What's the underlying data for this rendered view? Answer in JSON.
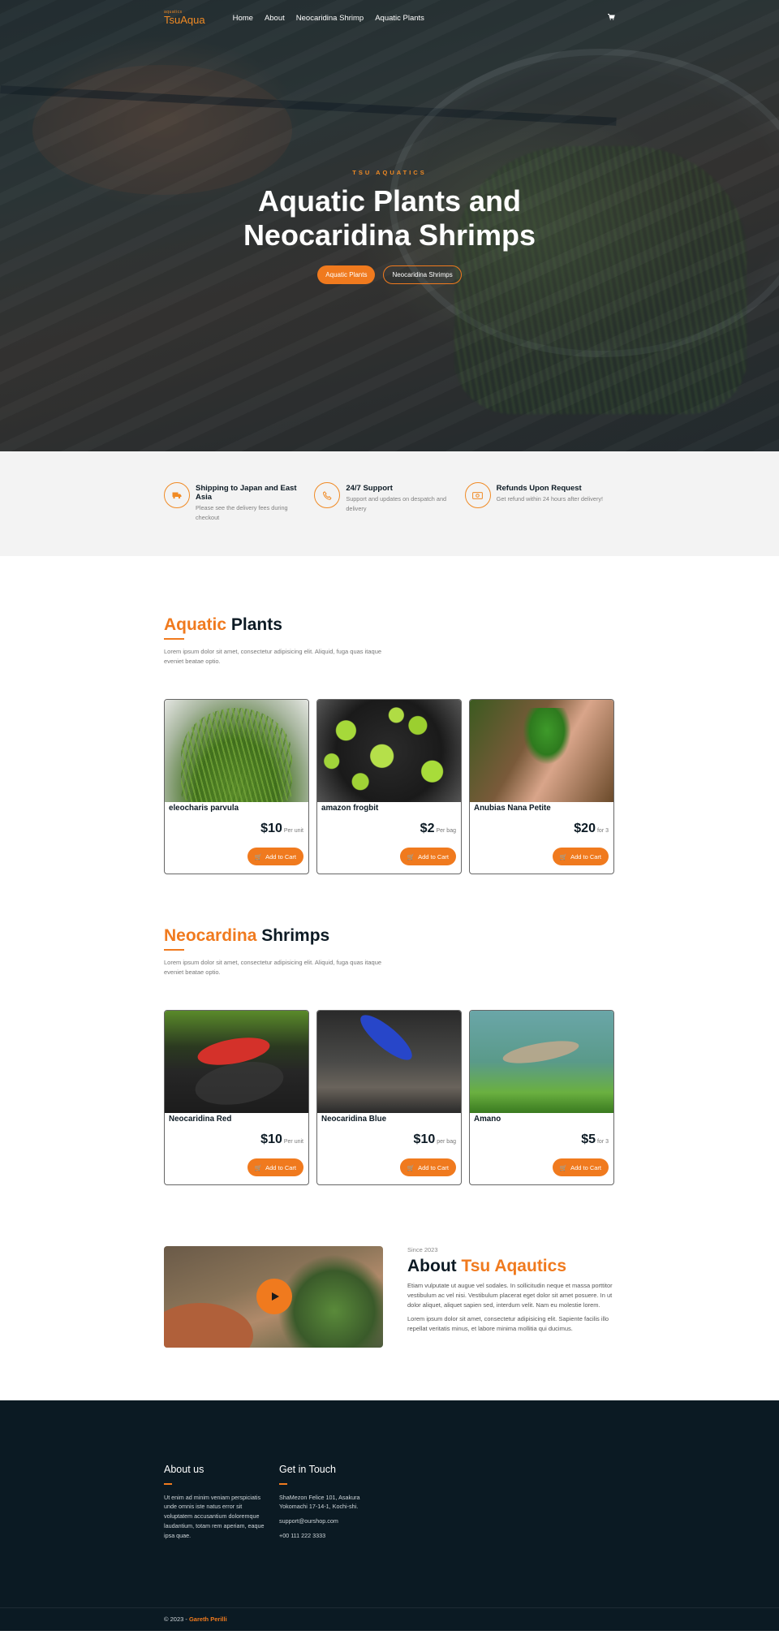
{
  "nav": {
    "logo_small": "aquatics",
    "logo": "TsuAqua",
    "links": [
      "Home",
      "About",
      "Neocaridina Shrimp",
      "Aquatic Plants"
    ],
    "cart_icon": "cart-icon"
  },
  "hero": {
    "eyebrow": "TSU AQUATICS",
    "title_line1": "Aquatic Plants and",
    "title_line2": "Neocaridina Shrimps",
    "btn_primary": "Aquatic Plants",
    "btn_secondary": "Neocaridina Shrimps"
  },
  "features": [
    {
      "icon": "truck-icon",
      "title": "Shipping to Japan and East Asia",
      "desc": "Please see the delivery fees during checkout"
    },
    {
      "icon": "phone-icon",
      "title": "24/7 Support",
      "desc": "Support and updates on despatch and delivery"
    },
    {
      "icon": "money-icon",
      "title": "Refunds Upon Request",
      "desc": "Get refund within 24 hours after delivery!"
    }
  ],
  "plants": {
    "title_accent": "Aquatic",
    "title_rest": " Plants",
    "desc": "Lorem ipsum dolor sit amet, consectetur adipisicing elit. Aliquid, fuga quas itaque eveniet beatae optio.",
    "items": [
      {
        "name": "eleocharis parvula",
        "price": "$10",
        "unit": "Per unit",
        "button": "Add to Cart"
      },
      {
        "name": "amazon frogbit",
        "price": "$2",
        "unit": "Per bag",
        "button": "Add to Cart"
      },
      {
        "name": "Anubias Nana Petite",
        "price": "$20",
        "unit": "for 3",
        "button": "Add to Cart"
      }
    ]
  },
  "shrimps": {
    "title_accent": "Neocardina",
    "title_rest": " Shrimps",
    "desc": "Lorem ipsum dolor sit amet, consectetur adipisicing elit. Aliquid, fuga quas itaque eveniet beatae optio.",
    "items": [
      {
        "name": "Neocaridina Red",
        "price": "$10",
        "unit": "Per unit",
        "button": "Add to Cart"
      },
      {
        "name": "Neocaridina Blue",
        "price": "$10",
        "unit": "per bag",
        "button": "Add to Cart"
      },
      {
        "name": "Amano",
        "price": "$5",
        "unit": "for 3",
        "button": "Add to Cart"
      }
    ]
  },
  "about": {
    "since": "Since 2023",
    "title_plain": "About ",
    "title_accent": "Tsu Aqautics",
    "p1": "Etiam vulputate ut augue vel sodales. In sollicitudin neque et massa porttitor vestibulum ac vel nisi. Vestibulum placerat eget dolor sit amet posuere. In ut dolor aliquet, aliquet sapien sed, interdum velit. Nam eu molestie lorem.",
    "p2": "Lorem ipsum dolor sit amet, consectetur adipisicing elit. Sapiente facilis illo repellat veritatis minus, et labore minima mollitia qui ducimus."
  },
  "footer": {
    "about_title": "About us",
    "about_text": "Ut enim ad minim veniam perspiciatis unde omnis iste natus error sit voluptatem accusantium doloremque laudantium, totam rem aperiam, eaque ipsa quae.",
    "contact_title": "Get in Touch",
    "address1": "ShaMezon Felice 101, Asakura",
    "address2": "Yokomachi 17-14-1, Kochi-shi.",
    "email": "support@ourshop.com",
    "phone": "+00 111 222 3333",
    "copyright": "© 2023 - ",
    "author": "Gareth Perilli"
  },
  "colors": {
    "accent": "#f07a1e",
    "dark": "#0b1a23"
  }
}
